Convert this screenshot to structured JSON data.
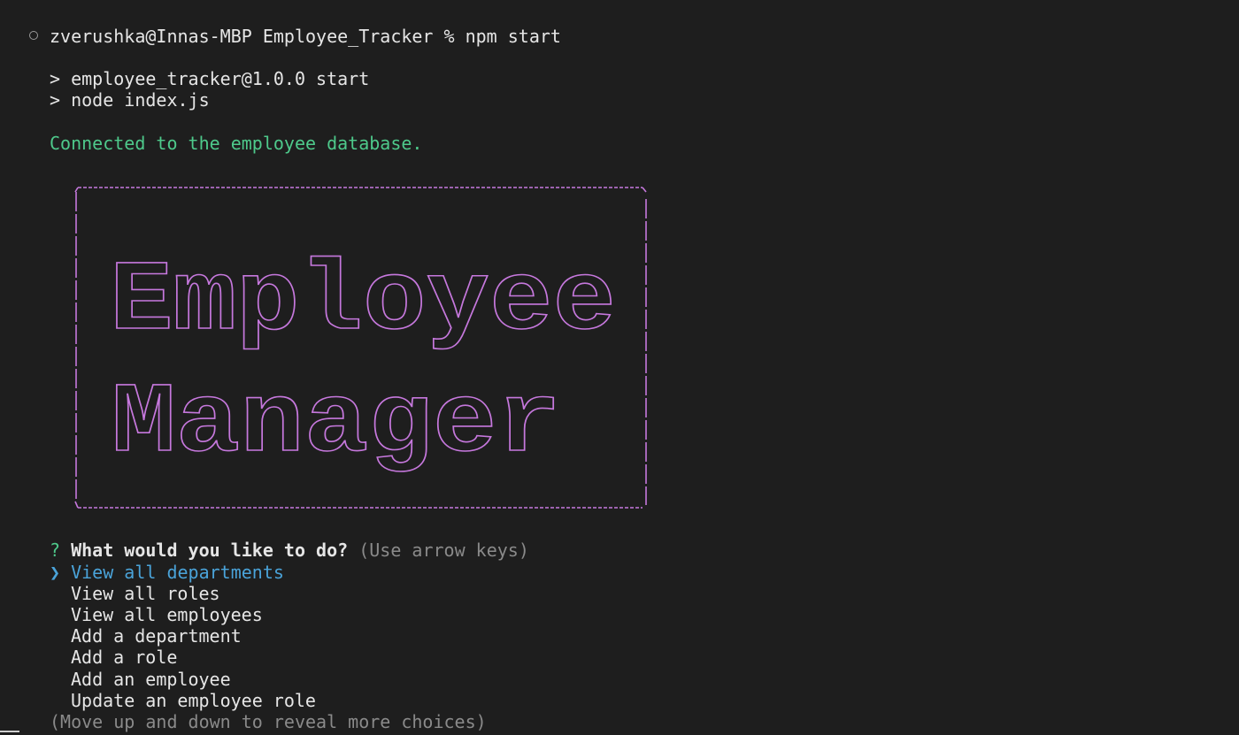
{
  "terminal": {
    "command_line": "zverushka@Innas-MBP Employee_Tracker % npm start",
    "npm_lines": [
      "> employee_tracker@1.0.0 start",
      "> node index.js"
    ],
    "connected_message": "Connected to the employee database."
  },
  "banner": {
    "line1": "Employee",
    "line2": "Manager",
    "color": "#c678dd"
  },
  "menu": {
    "question_mark": "?",
    "question": "What would you like to do?",
    "hint": "(Use arrow keys)",
    "pointer": "❯",
    "selected_index": 0,
    "choices": [
      "View all departments",
      "View all roles",
      "View all employees",
      "Add a department",
      "Add a role",
      "Add an employee",
      "Update an employee role"
    ],
    "footer": "(Move up and down to reveal more choices)"
  },
  "colors": {
    "background": "#1e1e1e",
    "text": "#d4d4d4",
    "success": "#4ec98b",
    "highlight": "#4aa3d9",
    "muted": "#8a8a8a",
    "banner": "#c678dd"
  }
}
